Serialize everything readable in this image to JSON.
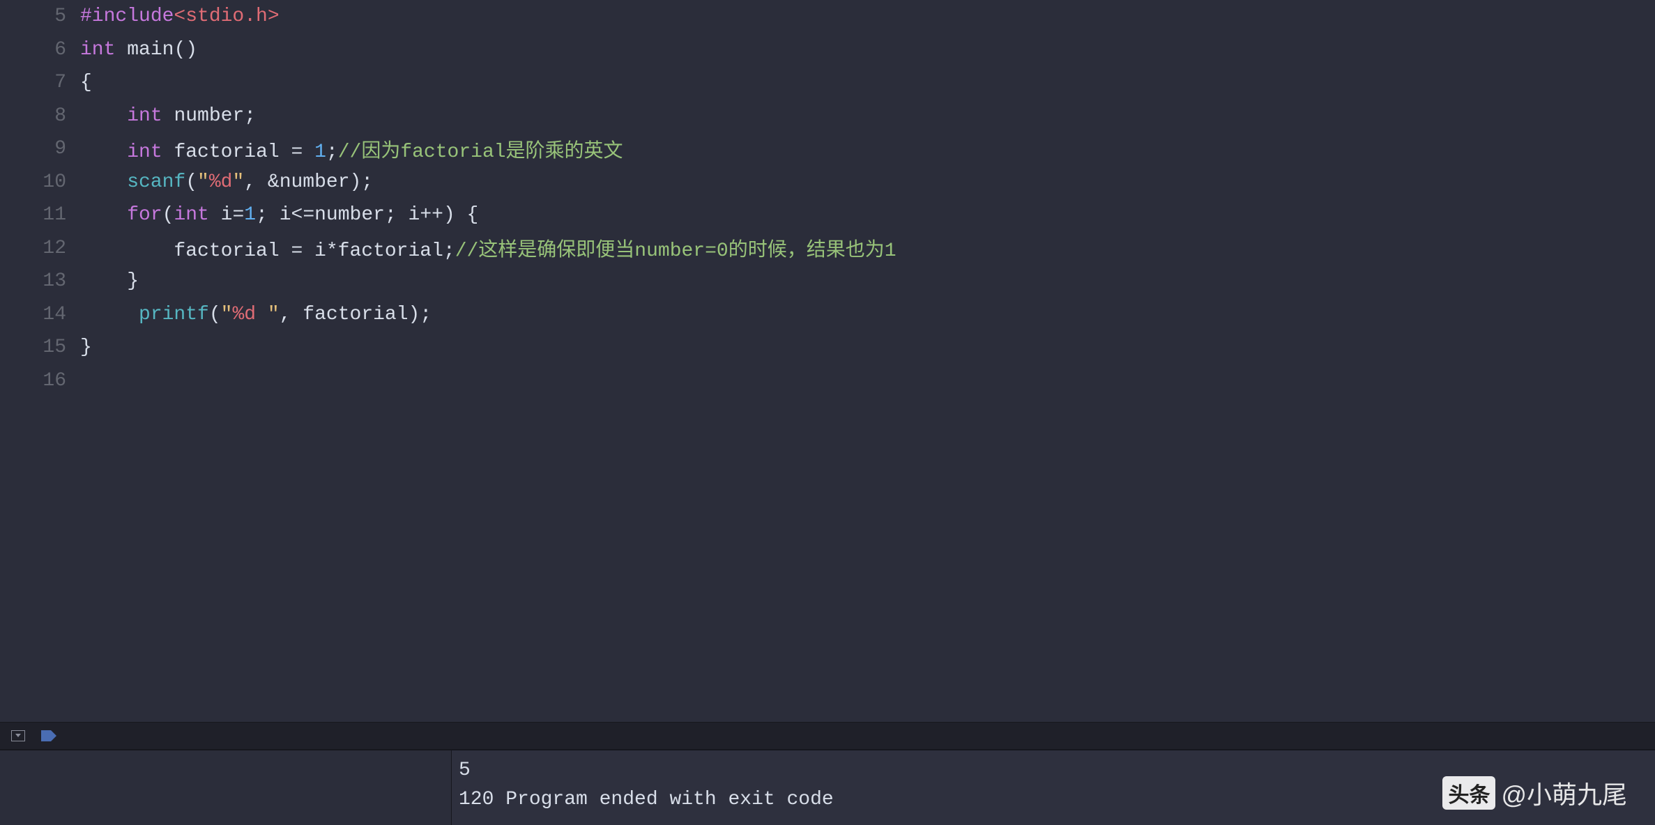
{
  "editor": {
    "lines": [
      {
        "num": "5"
      },
      {
        "num": "6"
      },
      {
        "num": "7"
      },
      {
        "num": "8"
      },
      {
        "num": "9"
      },
      {
        "num": "10"
      },
      {
        "num": "11"
      },
      {
        "num": "12"
      },
      {
        "num": "13"
      },
      {
        "num": "14"
      },
      {
        "num": "15"
      },
      {
        "num": "16"
      }
    ],
    "tokens": {
      "l5": {
        "preprocessor": "#include",
        "path": "<stdio.h>"
      },
      "l6": {
        "keyword": "int",
        "func": " main",
        "rest": "()"
      },
      "l7": {
        "brace": "{"
      },
      "l8": {
        "indent": "    ",
        "keyword": "int",
        "rest": " number;"
      },
      "l9": {
        "indent": "    ",
        "keyword": "int",
        "var": " factorial ",
        "eq": "= ",
        "num": "1",
        "semi": ";",
        "comment": "//因为factorial是阶乘的英文"
      },
      "l10": {
        "indent": "    ",
        "func": "scanf",
        "open": "(",
        "q1": "\"",
        "fmt": "%d",
        "q2": "\"",
        "rest": ", &number);"
      },
      "l11": {
        "indent": "    ",
        "forkw": "for",
        "open": "(",
        "intkw": "int",
        "ivar": " i=",
        "one": "1",
        "rest": "; i<=number; i++) {"
      },
      "l12": {
        "indent": "        ",
        "expr": "factorial = i*factorial;",
        "comment": "//这样是确保即便当number=0的时候，结果也为1"
      },
      "l13": {
        "indent": "    ",
        "brace": "}"
      },
      "l14": {
        "indent": "     ",
        "func": "printf",
        "open": "(",
        "q1": "\"",
        "fmt": "%d ",
        "q2": "\"",
        "rest": ", factorial);"
      },
      "l15": {
        "brace": "}"
      }
    }
  },
  "output": {
    "input_line": "5",
    "result_line": "120 Program ended with exit code"
  },
  "watermark": {
    "badge": "头条",
    "handle": "@小萌九尾"
  }
}
